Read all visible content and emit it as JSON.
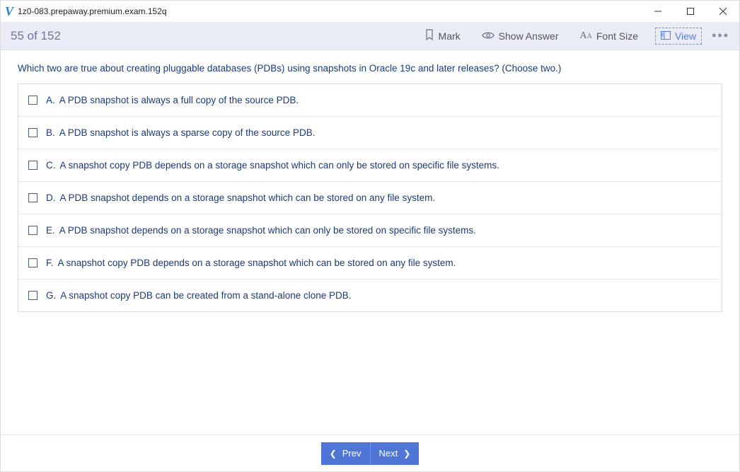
{
  "window": {
    "title": "1z0-083.prepaway.premium.exam.152q"
  },
  "toolbar": {
    "progress": "55 of 152",
    "mark": "Mark",
    "show_answer": "Show Answer",
    "font_size": "Font Size",
    "view": "View"
  },
  "question": {
    "text": "Which two are true about creating pluggable databases (PDBs) using snapshots in Oracle 19c and later releases? (Choose two.)",
    "options": [
      {
        "letter": "A.",
        "text": "A PDB snapshot is always a full copy of the source PDB."
      },
      {
        "letter": "B.",
        "text": "A PDB snapshot is always a sparse copy of the source PDB."
      },
      {
        "letter": "C.",
        "text": "A snapshot copy PDB depends on a storage snapshot which can only be stored on specific file systems."
      },
      {
        "letter": "D.",
        "text": "A PDB snapshot depends on a storage snapshot which can be stored on any file system."
      },
      {
        "letter": "E.",
        "text": "A PDB snapshot depends on a storage snapshot which can only be stored on specific file systems."
      },
      {
        "letter": "F.",
        "text": "A snapshot copy PDB depends on a storage snapshot which can be stored on any file system."
      },
      {
        "letter": "G.",
        "text": "A snapshot copy PDB can be created from a stand-alone clone PDB."
      }
    ]
  },
  "nav": {
    "prev": "Prev",
    "next": "Next"
  }
}
